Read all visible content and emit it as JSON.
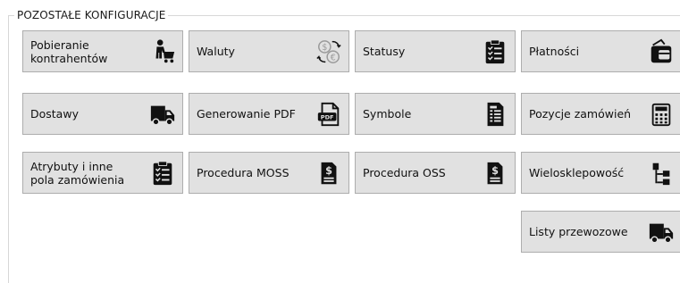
{
  "group": {
    "title": "POZOSTAŁE KONFIGURACJE"
  },
  "buttons": {
    "pobieranie": {
      "label": "Pobieranie\nkontrahentów",
      "icon": "customer-cart-icon"
    },
    "waluty": {
      "label": "Waluty",
      "icon": "currency-exchange-icon"
    },
    "statusy": {
      "label": "Statusy",
      "icon": "clipboard-checklist-icon"
    },
    "platnosci": {
      "label": "Płatności",
      "icon": "wallet-card-icon"
    },
    "dostawy": {
      "label": "Dostawy",
      "icon": "delivery-truck-icon"
    },
    "pdf": {
      "label": "Generowanie PDF",
      "icon": "pdf-file-icon"
    },
    "symbole": {
      "label": "Symbole",
      "icon": "document-list-icon"
    },
    "pozycje": {
      "label": "Pozycje zamówień",
      "icon": "calculator-icon"
    },
    "atrybuty": {
      "label": "Atrybuty i inne\npola zamówienia",
      "icon": "clipboard-checklist-icon"
    },
    "moss": {
      "label": "Procedura MOSS",
      "icon": "dollar-document-icon"
    },
    "oss": {
      "label": "Procedura OSS",
      "icon": "dollar-document-icon"
    },
    "wielosklep": {
      "label": "Wielosklepowość",
      "icon": "tree-structure-icon"
    },
    "listy": {
      "label": "Listy przewozowe",
      "icon": "delivery-truck-icon"
    }
  }
}
